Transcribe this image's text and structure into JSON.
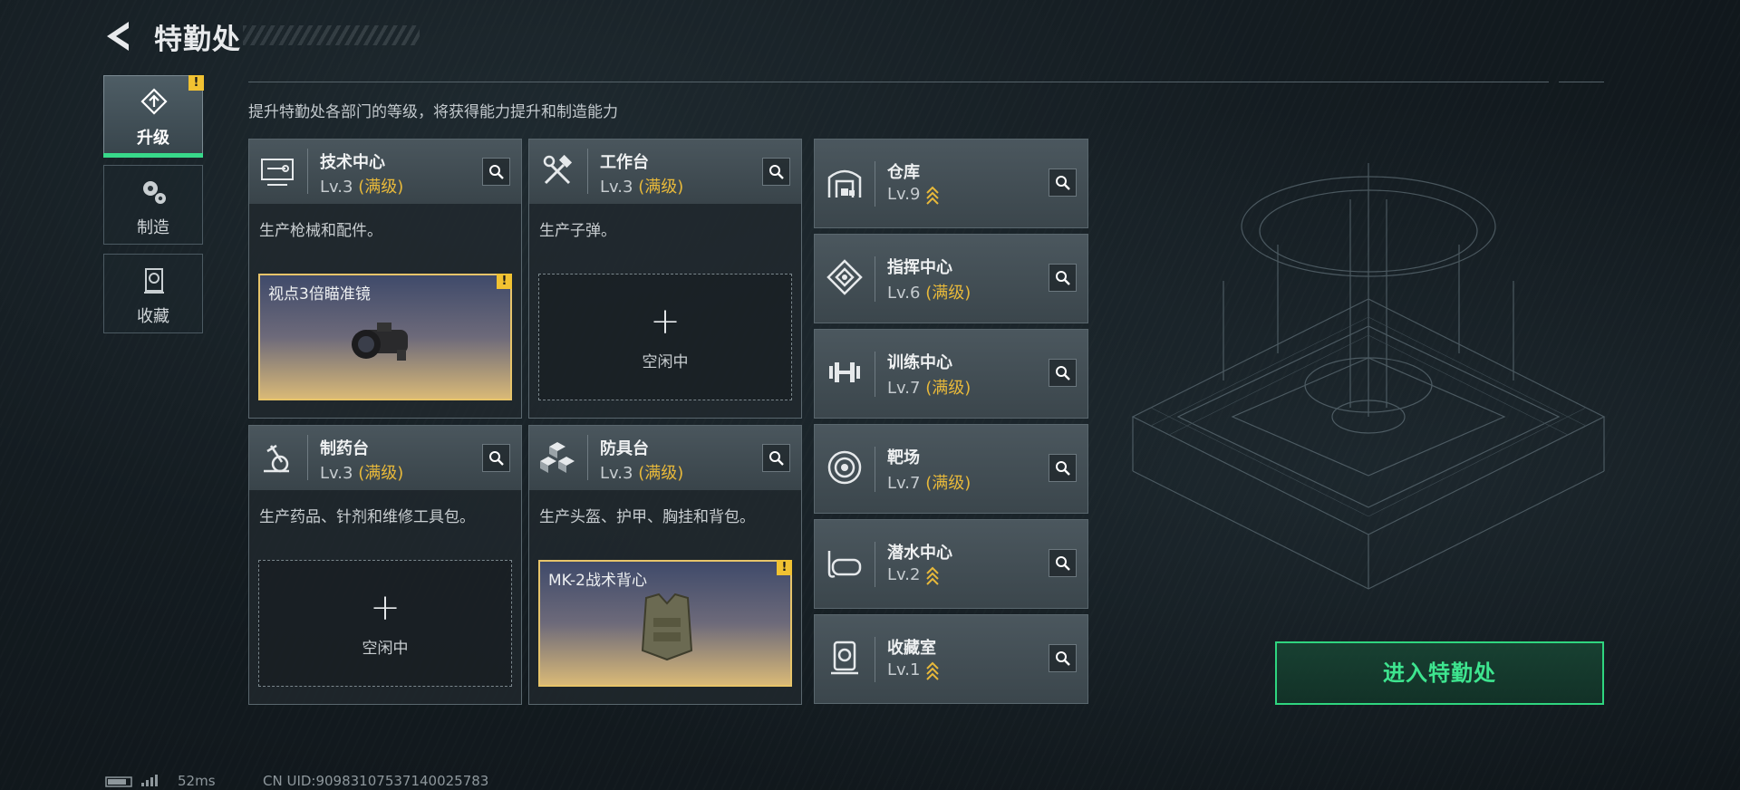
{
  "header": {
    "title": "特勤处"
  },
  "nav": {
    "items": [
      {
        "label": "升级",
        "icon": "upgrade-icon"
      },
      {
        "label": "制造",
        "icon": "gear-icon"
      },
      {
        "label": "收藏",
        "icon": "trophy-icon"
      }
    ],
    "alert": "!"
  },
  "subtitle": "提升特勤处各部门的等级，将获得能力提升和制造能力",
  "cards": [
    {
      "name": "技术中心",
      "level": "Lv.3",
      "status": "(满级)",
      "desc": "生产枪械和配件。",
      "slot": {
        "type": "busy",
        "item": "视点3倍瞄准镜",
        "alert": "!"
      }
    },
    {
      "name": "工作台",
      "level": "Lv.3",
      "status": "(满级)",
      "desc": "生产子弹。",
      "slot": {
        "type": "idle",
        "plus": "+",
        "label": "空闲中"
      }
    },
    {
      "name": "制药台",
      "level": "Lv.3",
      "status": "(满级)",
      "desc": "生产药品、针剂和维修工具包。",
      "slot": {
        "type": "idle",
        "plus": "+",
        "label": "空闲中"
      }
    },
    {
      "name": "防具台",
      "level": "Lv.3",
      "status": "(满级)",
      "desc": "生产头盔、护甲、胸挂和背包。",
      "slot": {
        "type": "busy",
        "item": "MK-2战术背心",
        "alert": "!"
      }
    }
  ],
  "facilities": [
    {
      "name": "仓库",
      "level": "Lv.9",
      "status": "",
      "upgradable": true,
      "icon": "warehouse-icon"
    },
    {
      "name": "指挥中心",
      "level": "Lv.6",
      "status": "(满级)",
      "upgradable": false,
      "icon": "command-icon"
    },
    {
      "name": "训练中心",
      "level": "Lv.7",
      "status": "(满级)",
      "upgradable": false,
      "icon": "dumbbell-icon"
    },
    {
      "name": "靶场",
      "level": "Lv.7",
      "status": "(满级)",
      "upgradable": false,
      "icon": "target-icon"
    },
    {
      "name": "潜水中心",
      "level": "Lv.2",
      "status": "",
      "upgradable": true,
      "icon": "dive-mask-icon"
    },
    {
      "name": "收藏室",
      "level": "Lv.1",
      "status": "",
      "upgradable": true,
      "icon": "collection-icon"
    }
  ],
  "enter_button": "进入特勤处",
  "status_bar": {
    "ping": "52ms",
    "uid": "CN UID:90983107537140025783"
  },
  "colors": {
    "accent": "#2fd57f",
    "gold": "#e8b93a",
    "alert": "#f1c232"
  }
}
